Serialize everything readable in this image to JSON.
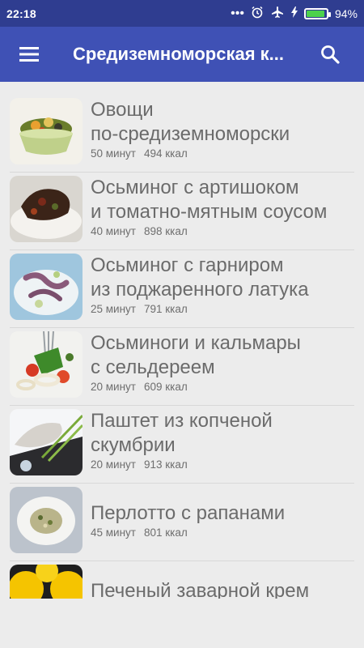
{
  "statusbar": {
    "time": "22:18",
    "dots": "•••",
    "battery_percent": "94%",
    "battery_level": 0.94,
    "icons": [
      "alarm-icon",
      "airplane-icon",
      "charging-icon"
    ]
  },
  "appbar": {
    "title": "Средиземноморская к...",
    "menu_icon": "hamburger-menu-icon",
    "search_icon": "search-icon"
  },
  "recipes": [
    {
      "name": "Овощи\nпо-средиземноморски",
      "time": "50 минут",
      "kcal": "494 ккал"
    },
    {
      "name": "Осьминог с артишоком\nи томатно-мятным соусом",
      "time": "40 минут",
      "kcal": "898 ккал"
    },
    {
      "name": "Осьминог с гарниром\nиз поджаренного латука",
      "time": "25 минут",
      "kcal": "791 ккал"
    },
    {
      "name": "Осьминоги и кальмары\nс сельдереем",
      "time": "20 минут",
      "kcal": "609 ккал"
    },
    {
      "name": "Паштет из копченой\nскумбрии",
      "time": "20 минут",
      "kcal": "913 ккал"
    },
    {
      "name": "Перлотто с рапанами",
      "time": "45 минут",
      "kcal": "801 ккал"
    },
    {
      "name": "Печеный заварной крем",
      "time": "",
      "kcal": ""
    }
  ],
  "colors": {
    "statusbar": "#2f3d90",
    "appbar": "#3f51b5",
    "background": "#ececec",
    "text": "#6b6b6b"
  }
}
